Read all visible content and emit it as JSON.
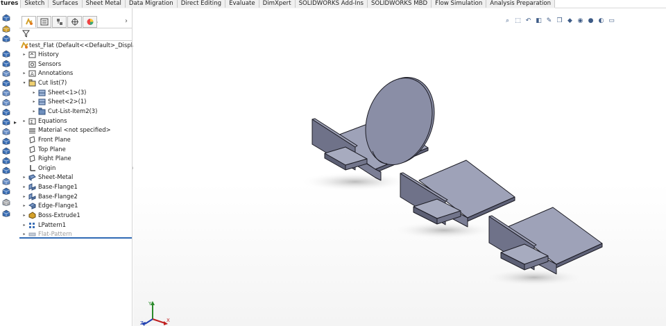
{
  "tabs": [
    "tures",
    "Sketch",
    "Surfaces",
    "Sheet Metal",
    "Data Migration",
    "Direct Editing",
    "Evaluate",
    "DimXpert",
    "SOLIDWORKS Add-Ins",
    "SOLIDWORKS MBD",
    "Flow Simulation",
    "Analysis Preparation"
  ],
  "tree": {
    "root": "test_Flat  (Default<<Default>_Display S",
    "items": [
      {
        "label": "History"
      },
      {
        "label": "Sensors"
      },
      {
        "label": "Annotations"
      },
      {
        "label": "Cut list(7)"
      },
      {
        "label": "Sheet<1>(3)"
      },
      {
        "label": "Sheet<2>(1)"
      },
      {
        "label": "Cut-List-Item2(3)"
      },
      {
        "label": "Equations"
      },
      {
        "label": "Material <not specified>"
      },
      {
        "label": "Front Plane"
      },
      {
        "label": "Top Plane"
      },
      {
        "label": "Right Plane"
      },
      {
        "label": "Origin"
      },
      {
        "label": "Sheet-Metal"
      },
      {
        "label": "Base-Flange1"
      },
      {
        "label": "Base-Flange2"
      },
      {
        "label": "Edge-Flange1"
      },
      {
        "label": "Boss-Extrude1"
      },
      {
        "label": "LPattern1"
      },
      {
        "label": "Flat-Pattern"
      }
    ]
  },
  "icons": {
    "left_toolbar": [
      "extrude-boss-icon",
      "revolve-boss-icon",
      "swept-boss-icon",
      "extrude-cut-icon",
      "hole-wizard-icon",
      "revolve-cut-icon",
      "swept-cut-icon",
      "lofted-cut-icon",
      "boundary-cut-icon",
      "fillet-icon",
      "linear-pattern-icon",
      "rib-icon",
      "draft-icon",
      "shell-icon",
      "wrap-icon",
      "intersect-icon",
      "reference-geometry-icon",
      "curves-icon",
      "instant3d-icon",
      "mirror-icon"
    ],
    "hud": [
      "zoom-to-fit-icon",
      "zoom-to-area-icon",
      "previous-view-icon",
      "section-view-icon",
      "dynamic-annotation-icon",
      "view-orientation-icon",
      "display-style-icon",
      "hide-show-items-icon",
      "edit-appearance-icon",
      "apply-scene-icon",
      "view-settings-icon"
    ]
  },
  "colors": {
    "part_face": "#8a8ea6",
    "part_face_dark": "#686b82",
    "part_edge": "#1c1c24",
    "accent": "#2f6ab5"
  }
}
